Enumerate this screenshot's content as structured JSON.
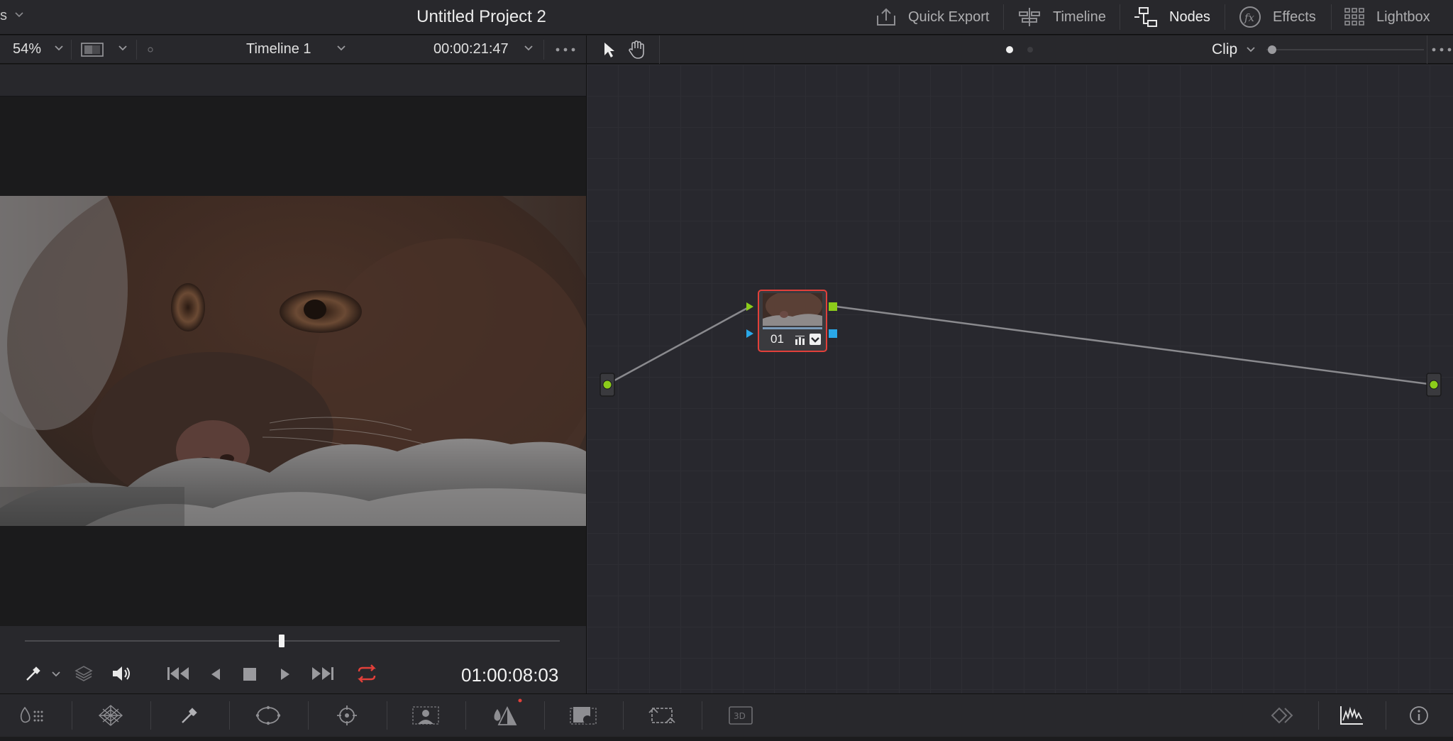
{
  "titlebar": {
    "left_fragment": "s",
    "project_title": "Untitled Project 2",
    "buttons": [
      {
        "label": "Quick Export",
        "icon": "export-icon"
      },
      {
        "label": "Timeline",
        "icon": "timeline-icon"
      },
      {
        "label": "Nodes",
        "icon": "nodes-icon",
        "active": true
      },
      {
        "label": "Effects",
        "icon": "fx-icon"
      },
      {
        "label": "Lightbox",
        "icon": "grid-icon"
      }
    ]
  },
  "viewer": {
    "zoom": "54%",
    "timeline_name": "Timeline 1",
    "duration_timecode": "00:00:21:47",
    "current_timecode": "01:00:08:03",
    "playhead_fraction": 0.48
  },
  "node_editor": {
    "mode_label": "Clip",
    "node": {
      "label": "01"
    }
  },
  "colors": {
    "accent_red": "#e2403a",
    "node_input_green": "#8ccc1a",
    "node_input_blue": "#2aa8e8",
    "panel": "#28282c"
  }
}
